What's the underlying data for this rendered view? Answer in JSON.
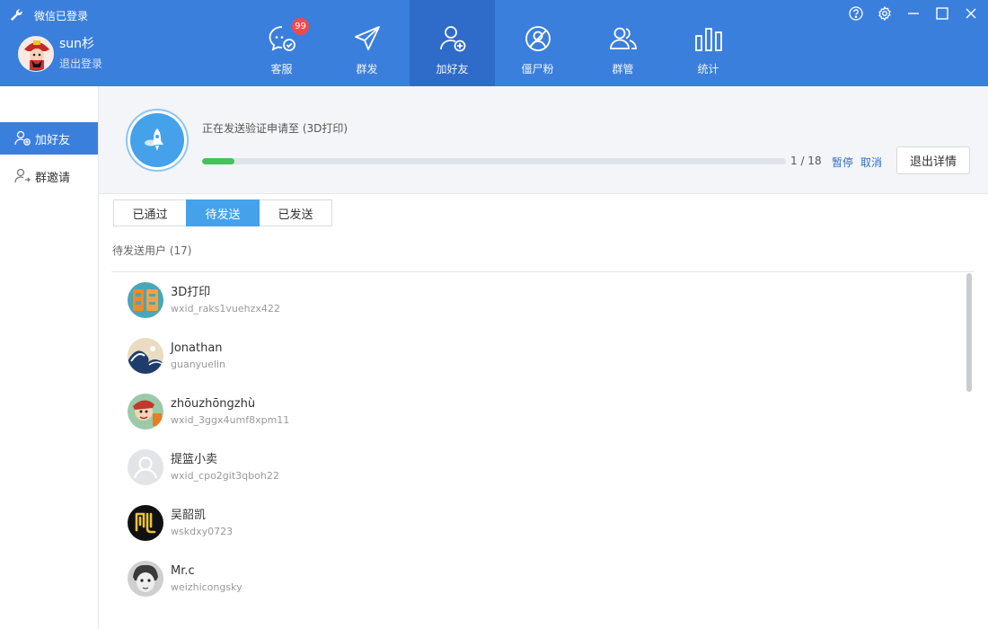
{
  "app": {
    "status": "微信已登录"
  },
  "user": {
    "name": "sun杉",
    "logout": "退出登录"
  },
  "nav": [
    {
      "label": "客服",
      "icon": "chat-check-icon",
      "badge": "99"
    },
    {
      "label": "群发",
      "icon": "paper-plane-icon"
    },
    {
      "label": "加好友",
      "icon": "add-friend-icon",
      "active": true
    },
    {
      "label": "僵尸粉",
      "icon": "zombie-fan-icon"
    },
    {
      "label": "群管",
      "icon": "group-manage-icon"
    },
    {
      "label": "统计",
      "icon": "bar-stats-icon"
    }
  ],
  "sidebar": {
    "items": [
      {
        "label": "加好友",
        "icon": "add-friend-icon",
        "active": true
      },
      {
        "label": "群邀请",
        "icon": "group-invite-icon"
      }
    ]
  },
  "progress": {
    "text": "正在发送验证申请至 (3D打印)",
    "current": 1,
    "total": 18,
    "count_text": "1 / 18",
    "pause": "暂停",
    "cancel": "取消",
    "exit": "退出详情"
  },
  "tabs": [
    {
      "label": "已通过"
    },
    {
      "label": "待发送",
      "active": true
    },
    {
      "label": "已发送"
    }
  ],
  "list": {
    "header": "待发送用户 (17)",
    "items": [
      {
        "name": "3D打印",
        "id": "wxid_raks1vuehzx422",
        "avatar": "orange-logo"
      },
      {
        "name": "Jonathan",
        "id": "guanyuelin",
        "avatar": "wave-painting"
      },
      {
        "name": "zhōuzhōngzhù",
        "id": "wxid_3ggx4umf8xpm11",
        "avatar": "cartoon"
      },
      {
        "name": "提篮小卖",
        "id": "wxid_cpo2git3qboh22",
        "avatar": "default-person"
      },
      {
        "name": "吴韶凯",
        "id": "wskdxy0723",
        "avatar": "kai-character"
      },
      {
        "name": "Mr.c",
        "id": "weizhicongsky",
        "avatar": "child-photo"
      }
    ]
  },
  "colors": {
    "topbar": "#3b7fdd",
    "nav_active": "#2f6bc9",
    "accent": "#45a2ea",
    "progress_fill": "#45c25a",
    "badge": "#f24a4a",
    "link": "#2f6fc9"
  }
}
